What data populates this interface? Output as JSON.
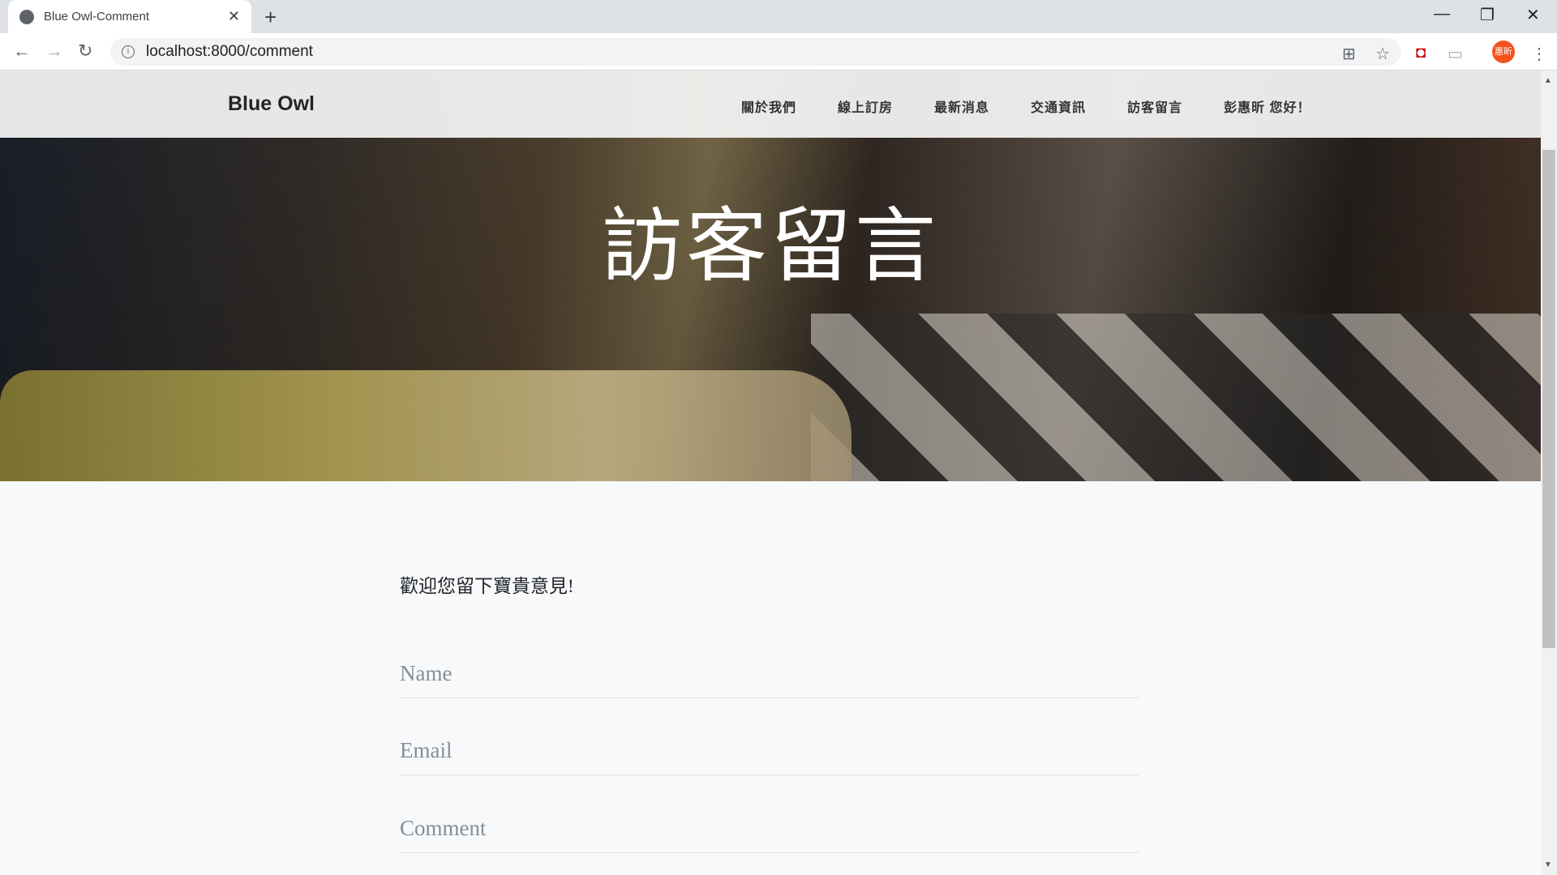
{
  "browser": {
    "tab_title": "Blue Owl-Comment",
    "url": "localhost:8000/comment",
    "profile": "惠昕"
  },
  "navbar": {
    "brand": "Blue Owl",
    "links": [
      "關於我們",
      "線上訂房",
      "最新消息",
      "交通資訊",
      "訪客留言",
      "彭惠昕 您好！"
    ]
  },
  "hero": {
    "title": "訪客留言"
  },
  "form": {
    "intro": "歡迎您留下寶貴意見!",
    "name_placeholder": "Name",
    "email_placeholder": "Email",
    "comment_placeholder": "Comment"
  },
  "colors": {
    "avatar": "#f4511e",
    "navbar": "#f5f5f5",
    "background": "#f8f9fa"
  }
}
